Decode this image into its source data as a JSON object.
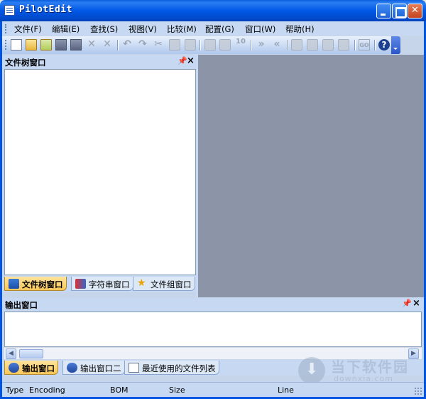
{
  "window": {
    "title": "PilotEdit"
  },
  "menubar": {
    "items": [
      {
        "label": "文件(F)"
      },
      {
        "label": "编辑(E)"
      },
      {
        "label": "查找(S)"
      },
      {
        "label": "视图(V)"
      },
      {
        "label": "比较(M)"
      },
      {
        "label": "配置(G)"
      },
      {
        "label": "窗口(W)"
      },
      {
        "label": "帮助(H)"
      }
    ]
  },
  "toolbar": {
    "compare_label": "10",
    "go_label": "GO",
    "help_label": "?"
  },
  "file_tree_panel": {
    "title": "文件树窗口",
    "pin_glyph": "ᵖ",
    "close_glyph": "×",
    "tabs": [
      {
        "label": "文件树窗口",
        "active": true
      },
      {
        "label": "字符串窗口",
        "active": false
      },
      {
        "label": "文件组窗口",
        "active": false
      }
    ]
  },
  "output_panel": {
    "title": "输出窗口",
    "tabs": [
      {
        "label": "输出窗口",
        "active": true
      },
      {
        "label": "输出窗口二",
        "active": false
      },
      {
        "label": "最近使用的文件列表",
        "active": false
      }
    ]
  },
  "statusbar": {
    "fields": [
      "Type",
      "Encoding",
      "BOM",
      "Size",
      "Line"
    ]
  },
  "watermark": {
    "text": "当下软件园",
    "sub": "downxia.com"
  },
  "colors": {
    "titlebar": "#0058e6",
    "editor_bg": "#8c95a8",
    "panel_bg": "#c6d8f2",
    "active_tab": "#fbc85a"
  }
}
